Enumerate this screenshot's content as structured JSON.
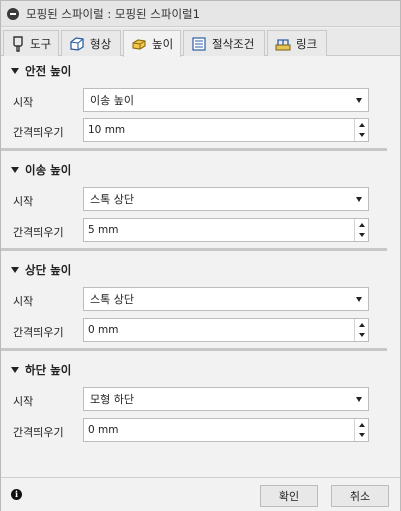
{
  "window": {
    "title": "모핑된 스파이럴 : 모핑된 스파이럴1"
  },
  "tabs": [
    {
      "label": "도구",
      "icon": "tool-icon"
    },
    {
      "label": "형상",
      "icon": "geometry-icon"
    },
    {
      "label": "높이",
      "icon": "heights-icon",
      "active": true
    },
    {
      "label": "절삭조건",
      "icon": "passes-icon"
    },
    {
      "label": "링크",
      "icon": "linking-icon"
    }
  ],
  "sections": {
    "clearance": {
      "title": "안전 높이",
      "from_label": "시작",
      "from_value": "이송 높이",
      "offset_label": "간격띄우기",
      "offset_value": "10 mm"
    },
    "retract": {
      "title": "이송 높이",
      "from_label": "시작",
      "from_value": "스톡 상단",
      "offset_label": "간격띄우기",
      "offset_value": "5 mm"
    },
    "top": {
      "title": "상단 높이",
      "from_label": "시작",
      "from_value": "스톡 상단",
      "offset_label": "간격띄우기",
      "offset_value": "0 mm"
    },
    "bottom": {
      "title": "하단 높이",
      "from_label": "시작",
      "from_value": "모형 하단",
      "offset_label": "간격띄우기",
      "offset_value": "0 mm"
    }
  },
  "footer": {
    "ok_label": "확인",
    "cancel_label": "취소",
    "info_icon": "info-icon"
  }
}
